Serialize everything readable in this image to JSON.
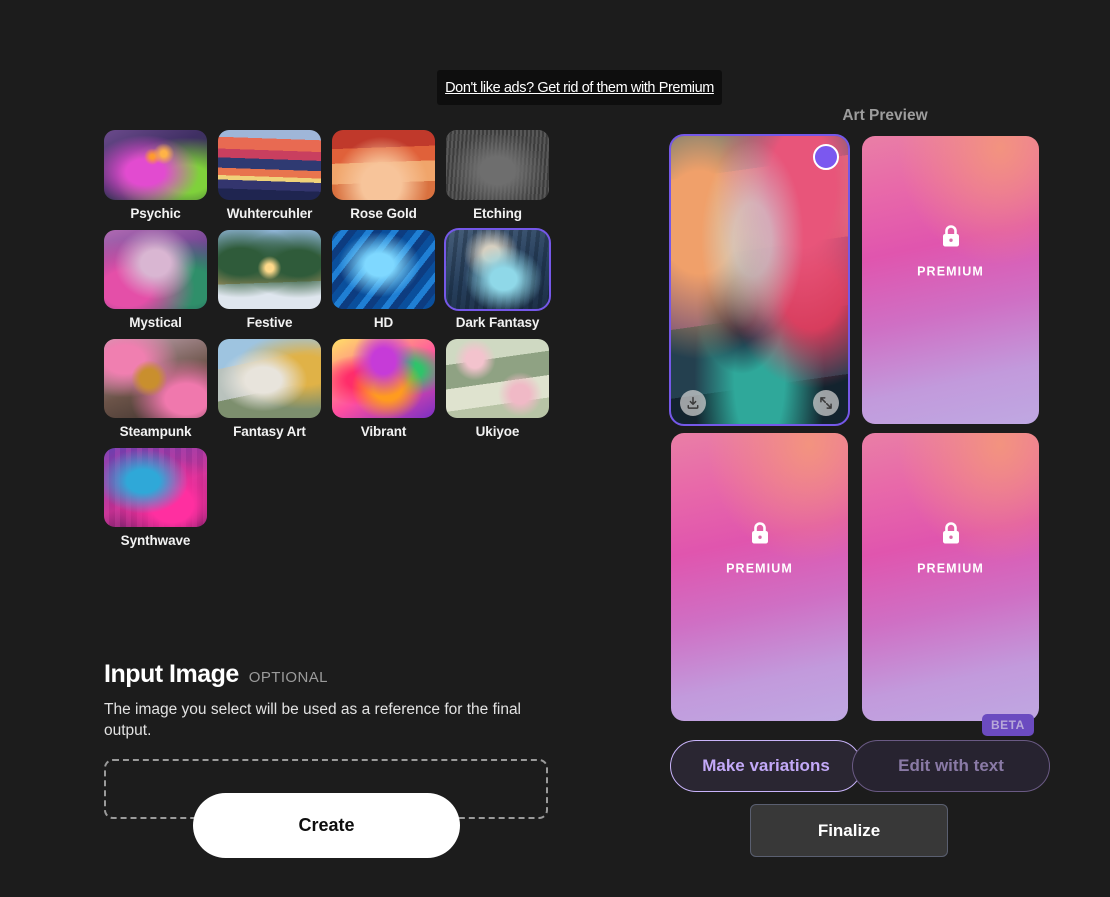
{
  "ad": {
    "text": "Don't like ads? Get rid of them with Premium"
  },
  "styles": {
    "items": [
      {
        "label": "Psychic",
        "selected": false,
        "art": "psychic"
      },
      {
        "label": "Wuhtercuhler",
        "selected": false,
        "art": "wuhtercuhler"
      },
      {
        "label": "Rose Gold",
        "selected": false,
        "art": "rosegold"
      },
      {
        "label": "Etching",
        "selected": false,
        "art": "etching"
      },
      {
        "label": "Mystical",
        "selected": false,
        "art": "mystical"
      },
      {
        "label": "Festive",
        "selected": false,
        "art": "festive"
      },
      {
        "label": "HD",
        "selected": false,
        "art": "hd"
      },
      {
        "label": "Dark Fantasy",
        "selected": true,
        "art": "darkfantasy"
      },
      {
        "label": "Steampunk",
        "selected": false,
        "art": "steampunk"
      },
      {
        "label": "Fantasy Art",
        "selected": false,
        "art": "fantasyart"
      },
      {
        "label": "Vibrant",
        "selected": false,
        "art": "vibrant"
      },
      {
        "label": "Ukiyoe",
        "selected": false,
        "art": "ukiyoe"
      },
      {
        "label": "Synthwave",
        "selected": false,
        "art": "synthwave"
      }
    ]
  },
  "input_image": {
    "title": "Input Image",
    "optional_tag": "OPTIONAL",
    "description": "The image you select will be used as a reference for the final output."
  },
  "create_button": {
    "label": "Create"
  },
  "art_preview": {
    "title": "Art Preview",
    "cards": [
      {
        "type": "generated",
        "selected": true,
        "label": ""
      },
      {
        "type": "premium",
        "selected": false,
        "label": "PREMIUM"
      },
      {
        "type": "premium",
        "selected": false,
        "label": "PREMIUM"
      },
      {
        "type": "premium",
        "selected": false,
        "label": "PREMIUM"
      }
    ]
  },
  "actions": {
    "make_variations": "Make variations",
    "edit_with_text": "Edit with text",
    "beta_badge": "BETA",
    "finalize": "Finalize"
  },
  "colors": {
    "background": "#1c1c1c",
    "accent_purple": "#7558e8",
    "premium_pink": "#e055ae",
    "finalize_fill": "#383838"
  }
}
